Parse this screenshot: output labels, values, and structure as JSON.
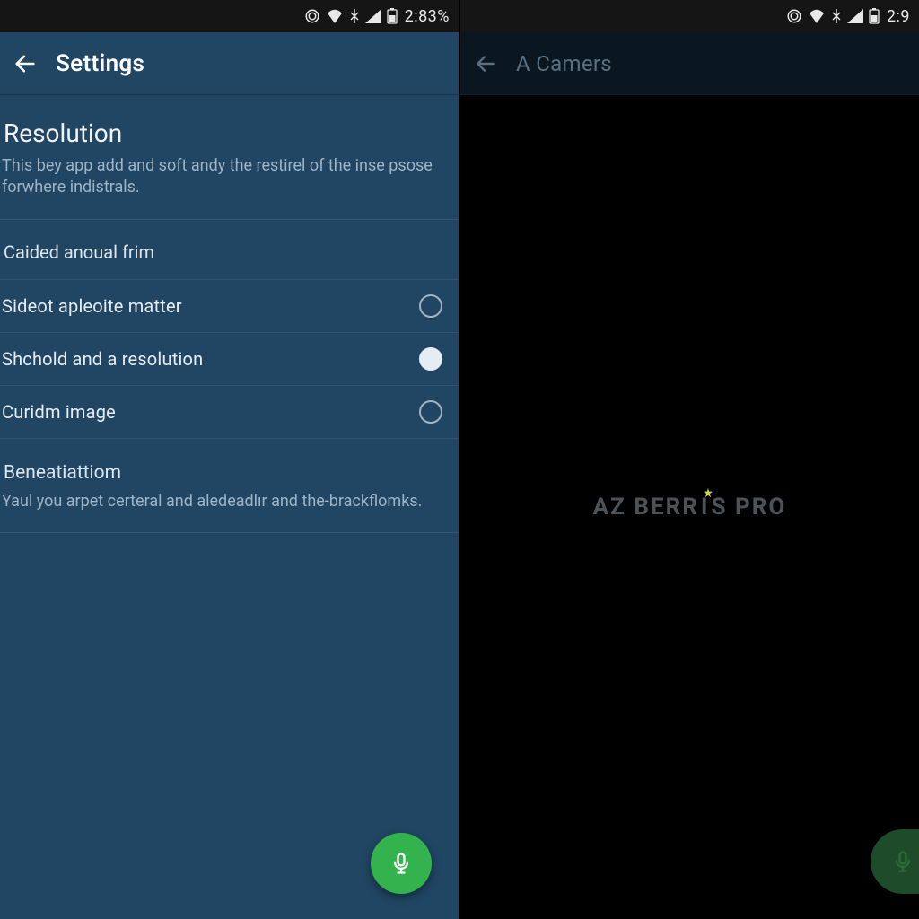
{
  "left": {
    "statusbar": {
      "battery_text": "2:83%"
    },
    "appbar": {
      "title": "Settings"
    },
    "section1": {
      "title": "Resolution",
      "desc": "This bey app add and soft andy the restirel of the inse psose forwhere indistrals."
    },
    "group_label": "Caided anoual frim",
    "options": [
      {
        "label": "Sideot apleoite matter",
        "selected": false
      },
      {
        "label": "Shchold and a resolution",
        "selected": true
      },
      {
        "label": "Curidm image",
        "selected": false
      }
    ],
    "section2": {
      "title": "Beneatiattiom",
      "desc": "Yaul you arpet certeral and aledeadlır and the-brackflomks."
    }
  },
  "right": {
    "statusbar": {
      "battery_text": "2:9"
    },
    "appbar": {
      "title": "A Camers"
    },
    "watermark": "AZ BERRIS PRO"
  },
  "colors": {
    "left_bg": "#204664",
    "fab": "#33b24e",
    "right_bg": "#000000"
  }
}
